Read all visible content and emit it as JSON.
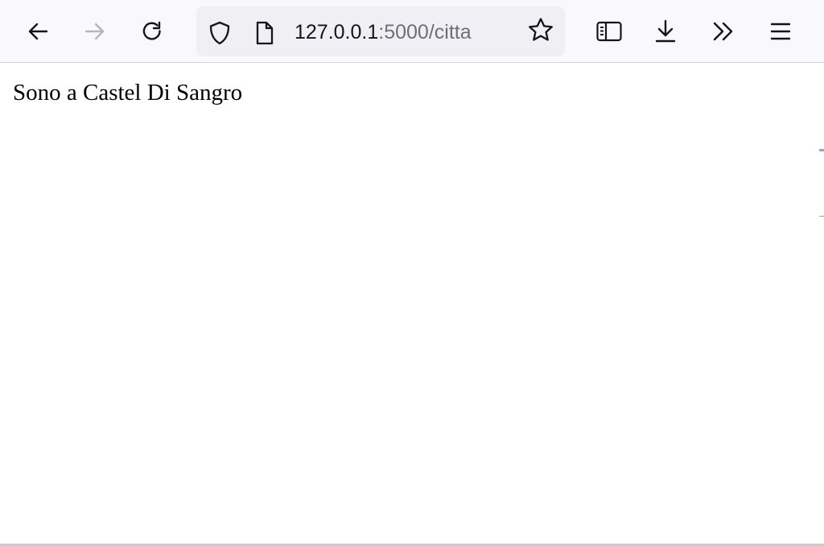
{
  "browser": {
    "nav": {
      "back_icon": "arrow-left-icon",
      "forward_icon": "arrow-right-icon",
      "reload_icon": "reload-icon"
    },
    "urlbar": {
      "shield_icon": "tracking-protection-shield-icon",
      "page_icon": "page-info-icon",
      "url_host": "127.0.0.1",
      "url_rest": ":5000/citta",
      "bookmark_icon": "star-icon"
    },
    "tools": {
      "sidebar_icon": "sidebar-icon",
      "downloads_icon": "download-icon",
      "overflow_icon": "chevrons-right-icon",
      "menu_icon": "hamburger-menu-icon"
    },
    "colors": {
      "toolbar_bg": "#f9f9fb",
      "urlbar_bg": "#f0f0f4",
      "icon": "#15141a",
      "icon_disabled": "#b5b5bd"
    }
  },
  "page": {
    "text": "Sono a Castel Di Sangro"
  }
}
